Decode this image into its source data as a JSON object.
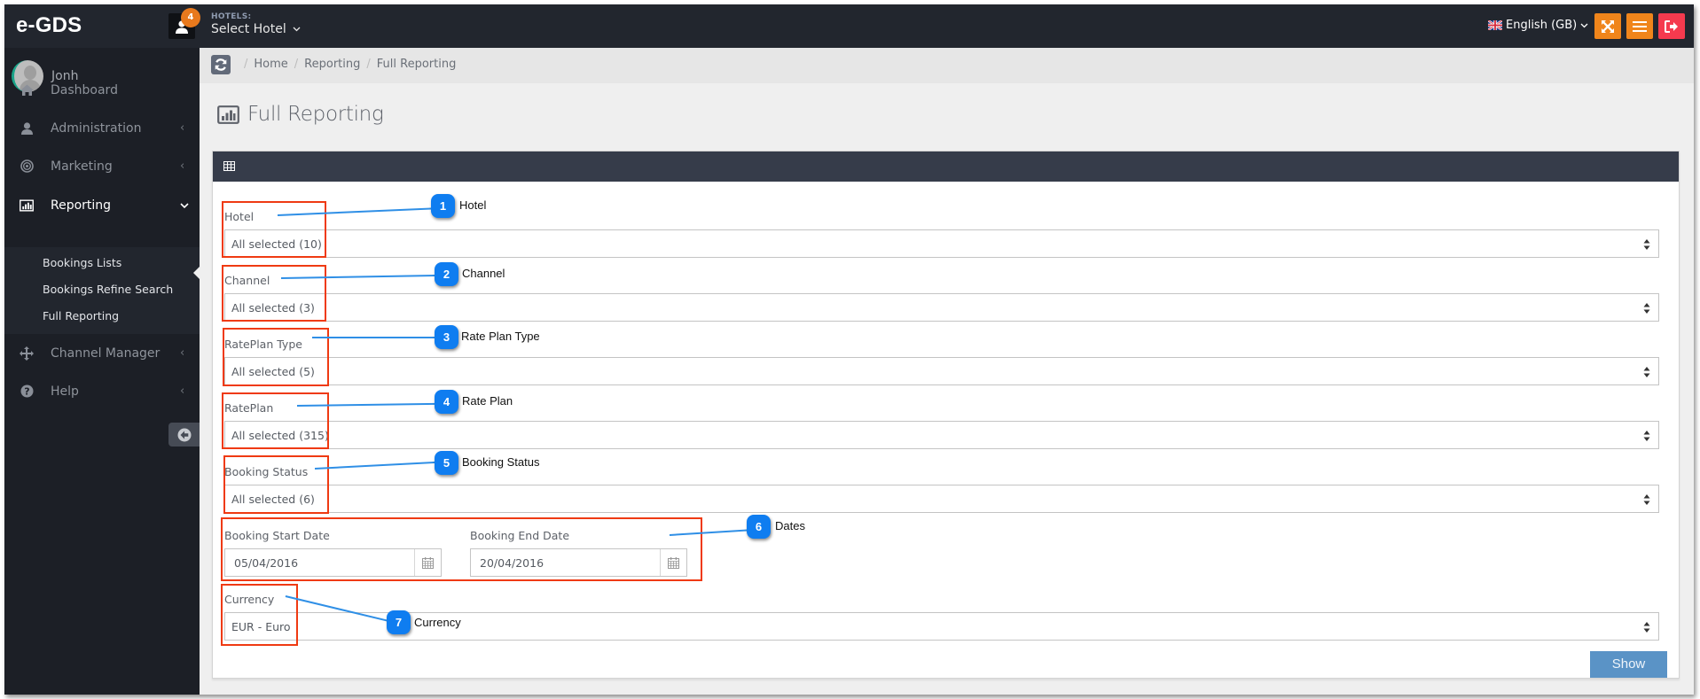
{
  "header": {
    "logo": "e-GDS",
    "notification_count": "4",
    "hotels_caption": "HOTELS:",
    "hotel_select": "Select Hotel",
    "language": "English (GB)",
    "icons": [
      "fullscreen-icon",
      "menu-icon",
      "logout-icon"
    ],
    "colors": {
      "orange": "#f0851b",
      "red": "#f53a4e",
      "bar": "#22262e"
    }
  },
  "sidebar": {
    "user_name": "Jonh",
    "items": [
      {
        "label": "Dashboard",
        "icon": "home-icon",
        "has_chevron": false
      },
      {
        "label": "Administration",
        "icon": "user-icon",
        "has_chevron": true
      },
      {
        "label": "Marketing",
        "icon": "target-icon",
        "has_chevron": true
      },
      {
        "label": "Reporting",
        "icon": "bar-chart-icon",
        "has_chevron": true,
        "expanded": true,
        "active": true
      },
      {
        "label": "Channel Manager",
        "icon": "move-arrows-icon",
        "has_chevron": true
      },
      {
        "label": "Help",
        "icon": "question-circle-icon",
        "has_chevron": true
      }
    ],
    "submenu": [
      {
        "label": "Bookings Lists"
      },
      {
        "label": "Bookings Refine Search"
      },
      {
        "label": "Full Reporting",
        "active": true
      }
    ]
  },
  "breadcrumb": [
    "Home",
    "Reporting",
    "Full Reporting"
  ],
  "page": {
    "title": "Full Reporting"
  },
  "form": {
    "fields": [
      {
        "label": "Hotel",
        "value": "All selected (10)"
      },
      {
        "label": "Channel",
        "value": "All selected (3)"
      },
      {
        "label": "RatePlan Type",
        "value": "All selected (5)"
      },
      {
        "label": "RatePlan",
        "value": "All selected (315)"
      },
      {
        "label": "Booking Status",
        "value": "All selected (6)"
      }
    ],
    "start_date_label": "Booking Start Date",
    "start_date": "05/04/2016",
    "end_date_label": "Booking End Date",
    "end_date": "20/04/2016",
    "currency_label": "Currency",
    "currency": "EUR - Euro",
    "show_button": "Show"
  },
  "annotations": [
    {
      "number": "1",
      "text": "Hotel"
    },
    {
      "number": "2",
      "text": "Channel"
    },
    {
      "number": "3",
      "text": "Rate Plan Type"
    },
    {
      "number": "4",
      "text": "Rate Plan"
    },
    {
      "number": "5",
      "text": "Booking Status"
    },
    {
      "number": "6",
      "text": "Dates"
    },
    {
      "number": "7",
      "text": "Currency"
    }
  ]
}
